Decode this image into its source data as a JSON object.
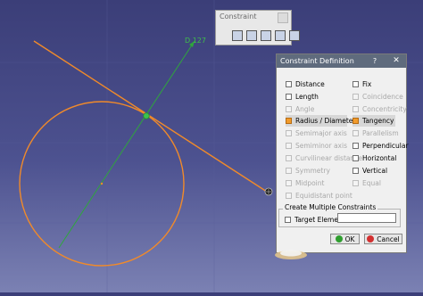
{
  "viewport": {
    "dimension_label": "D 127",
    "colors": {
      "background_top": "#3b3e78",
      "geometry_line": "#f08a2a",
      "constraint_line": "#2fa63c",
      "tangent_marker": "#3cc24d"
    }
  },
  "toolbar": {
    "title": "Constraint",
    "icons": [
      "constraint-icon",
      "contact-constraint-icon",
      "fix-together-icon",
      "auto-constraint-icon",
      "animate-constraint-icon"
    ]
  },
  "dialog": {
    "title": "Constraint Definition",
    "help_label": "?",
    "close_label": "✕",
    "left_column": [
      {
        "label": "Distance",
        "enabled": true,
        "checked": false
      },
      {
        "label": "Length",
        "enabled": true,
        "checked": false
      },
      {
        "label": "Angle",
        "enabled": false,
        "checked": false
      },
      {
        "label": "Radius / Diameter",
        "enabled": true,
        "checked": true
      },
      {
        "label": "Semimajor axis",
        "enabled": false,
        "checked": false
      },
      {
        "label": "Semiminor axis",
        "enabled": false,
        "checked": false
      },
      {
        "label": "Curvilinear distance",
        "enabled": false,
        "checked": false
      },
      {
        "label": "Symmetry",
        "enabled": false,
        "checked": false
      },
      {
        "label": "Midpoint",
        "enabled": false,
        "checked": false
      },
      {
        "label": "Equidistant point",
        "enabled": false,
        "checked": false
      }
    ],
    "right_column": [
      {
        "label": "Fix",
        "enabled": true,
        "checked": false
      },
      {
        "label": "Coincidence",
        "enabled": false,
        "checked": false
      },
      {
        "label": "Concentricity",
        "enabled": false,
        "checked": false
      },
      {
        "label": "Tangency",
        "enabled": true,
        "checked": true
      },
      {
        "label": "Parallelism",
        "enabled": false,
        "checked": false
      },
      {
        "label": "Perpendicular",
        "enabled": true,
        "checked": false
      },
      {
        "label": "Horizontal",
        "enabled": true,
        "checked": false
      },
      {
        "label": "Vertical",
        "enabled": true,
        "checked": false
      },
      {
        "label": "Equal",
        "enabled": false,
        "checked": false
      }
    ],
    "group_title": "Create Multiple Constraints",
    "target_label": "Target Element",
    "target_value": "",
    "ok_label": "OK",
    "cancel_label": "Cancel"
  }
}
